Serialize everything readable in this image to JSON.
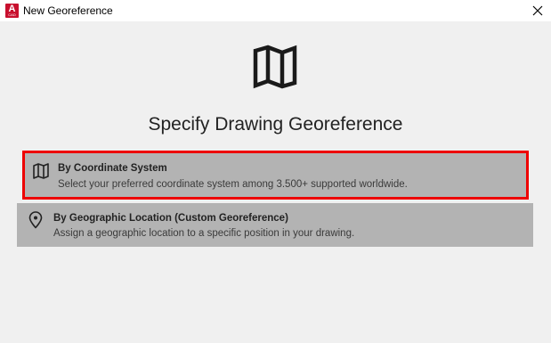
{
  "window": {
    "title": "New Georeference",
    "app_icon_letter": "A",
    "app_icon_sub": "CAD",
    "close_symbol": "✕"
  },
  "hero": {
    "icon": "map-icon",
    "heading": "Specify Drawing Georeference"
  },
  "options": [
    {
      "icon": "map-icon",
      "title": "By Coordinate System",
      "description": "Select your preferred coordinate system among 3.500+ supported worldwide.",
      "selected": true
    },
    {
      "icon": "location-pin-icon",
      "title": "By Geographic Location (Custom Georeference)",
      "description": "Assign a geographic location to a specific position in your drawing.",
      "selected": false
    }
  ],
  "colors": {
    "background": "#f0f0f0",
    "option_background": "#b3b3b3",
    "selection_border": "#ee0000",
    "app_icon": "#c8102e"
  }
}
